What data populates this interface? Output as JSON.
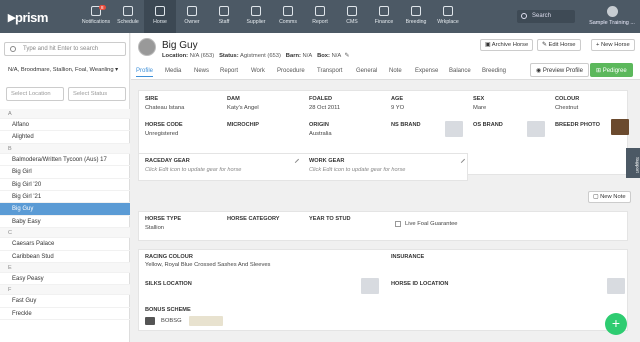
{
  "nav": {
    "logo": "prism",
    "items": [
      {
        "label": "Notifications",
        "badge": "8"
      },
      {
        "label": "Schedule"
      },
      {
        "label": "Horse"
      },
      {
        "label": "Owner"
      },
      {
        "label": "Staff"
      },
      {
        "label": "Supplier"
      },
      {
        "label": "Comms"
      },
      {
        "label": "Report"
      },
      {
        "label": "CMS"
      },
      {
        "label": "Finance"
      },
      {
        "label": "Breeding"
      },
      {
        "label": "Wrkplace"
      }
    ],
    "search_label": "Search",
    "user": "Sample Training ..."
  },
  "sidebar": {
    "search_placeholder": "Type and hit Enter to search",
    "filter": "N/A, Broodmare, Stallion, Foal, Weanling ▾",
    "select_location": "Select Location",
    "select_status": "Select Status",
    "items": [
      {
        "t": "A",
        "h": true
      },
      {
        "t": "Alfano"
      },
      {
        "t": "Alighted"
      },
      {
        "t": "B",
        "h": true
      },
      {
        "t": "Balmodera/Written Tycoon (Aus) 17"
      },
      {
        "t": "Big Girl"
      },
      {
        "t": "Big Girl '20"
      },
      {
        "t": "Big Girl '21"
      },
      {
        "t": "Big Guy",
        "s": true
      },
      {
        "t": "Baby Easy"
      },
      {
        "t": "C",
        "h": true
      },
      {
        "t": "Caesars Palace"
      },
      {
        "t": "Caribbean Stud"
      },
      {
        "t": "E",
        "h": true
      },
      {
        "t": "Easy Peasy"
      },
      {
        "t": "F",
        "h": true
      },
      {
        "t": "Fast Guy"
      },
      {
        "t": "Freckle"
      }
    ]
  },
  "profile": {
    "name": "Big Guy",
    "meta": {
      "location_label": "Location:",
      "location": "N/A (653)",
      "status_label": "Status:",
      "status": "Agistment (653)",
      "barn_label": "Barn:",
      "barn": "N/A",
      "box_label": "Box:",
      "box": "N/A"
    },
    "buttons": {
      "archive": "Archive Horse",
      "edit": "Edit Horse",
      "new": "+ New Horse",
      "preview": "Preview Profile",
      "pedigree": "Pedigree"
    },
    "tabs": [
      "Profile",
      "Media",
      "News",
      "Report",
      "Work",
      "Procedure",
      "Transport",
      "General",
      "Note",
      "Expense",
      "Balance",
      "Breeding"
    ]
  },
  "details": {
    "sire_label": "SIRE",
    "sire": "Chateau Istana",
    "dam_label": "DAM",
    "dam": "Katy's Angel",
    "foaled_label": "FOALED",
    "foaled": "28 Oct 2011",
    "age_label": "AGE",
    "age": "9 YO",
    "sex_label": "SEX",
    "sex": "Mare",
    "colour_label": "COLOUR",
    "colour": "Chestnut",
    "horse_code_label": "HORSE CODE",
    "horse_code": "Unregistered",
    "microchip_label": "MICROCHIP",
    "origin_label": "ORIGIN",
    "origin": "Australia",
    "ns_brand_label": "NS BRAND",
    "os_brand_label": "OS BRAND",
    "breedr_label": "BREEDR PHOTO"
  },
  "gear": {
    "raceday_label": "RACEDAY GEAR",
    "raceday_hint": "Click Edit icon to update gear for horse",
    "work_label": "WORK GEAR",
    "work_hint": "Click Edit icon to update gear for horse"
  },
  "new_note": "New Note",
  "stud": {
    "type_label": "HORSE TYPE",
    "type": "Stallion",
    "category_label": "HORSE CATEGORY",
    "year_label": "YEAR TO STUD",
    "live_foal": "Live Foal Guarantee"
  },
  "racing": {
    "colour_label": "RACING COLOUR",
    "colour": "Yellow, Royal Blue Crossed Sashes And Sleeves",
    "insurance_label": "INSURANCE",
    "silks_label": "SILKS LOCATION",
    "horse_id_label": "HORSE ID LOCATION",
    "bonus_label": "BONUS SCHEME",
    "bonus_value": "BOBSG"
  },
  "support": "Support"
}
